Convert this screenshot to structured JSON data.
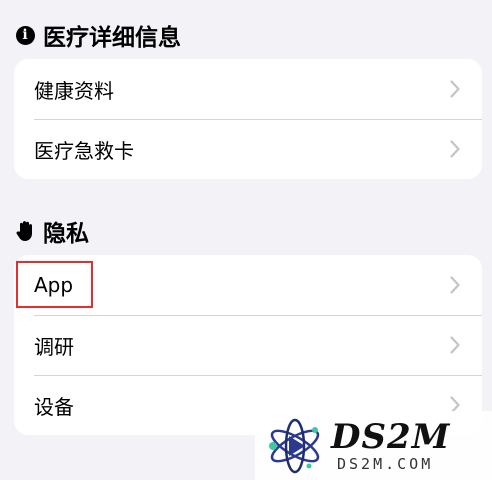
{
  "sections": {
    "medical": {
      "title": "医疗详细信息",
      "icon": "info-circle-icon",
      "items": [
        {
          "label": "健康资料"
        },
        {
          "label": "医疗急救卡"
        }
      ]
    },
    "privacy": {
      "title": "隐私",
      "icon": "raised-hand-icon",
      "items": [
        {
          "label": "App"
        },
        {
          "label": "调研"
        },
        {
          "label": "设备"
        }
      ]
    }
  },
  "info_glyph": "i",
  "watermark": {
    "name": "DS2M",
    "domain": "DS2M.COM"
  },
  "colors": {
    "background": "#f2f2f7",
    "card": "#ffffff",
    "separator": "#d4d4d8",
    "chevron": "#c4c4c8",
    "highlight": "#e03030"
  }
}
